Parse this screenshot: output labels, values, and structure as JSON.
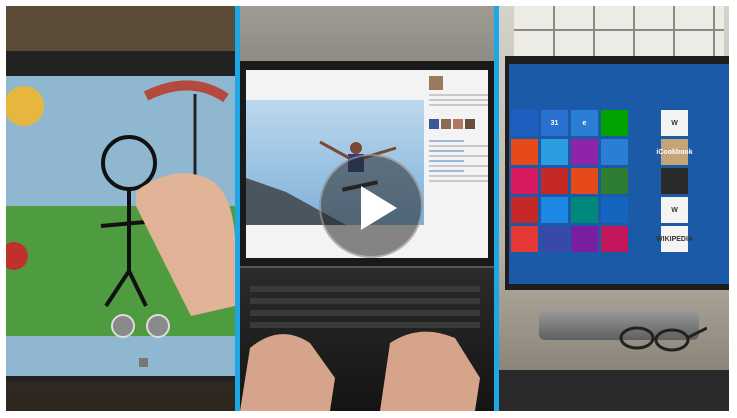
{
  "video": {
    "play_button_label": "Play video",
    "separator_color": "#1ea7e6"
  },
  "start_screen": {
    "tiles": [
      {
        "label": "",
        "color": "#1f5fbf",
        "icon": "tile"
      },
      {
        "label": "31",
        "color": "#2a72d1",
        "icon": "calendar-icon"
      },
      {
        "label": "e",
        "color": "#2a7fd4",
        "icon": "ie-icon"
      },
      {
        "label": "",
        "color": "#00a300",
        "icon": "store-icon"
      },
      {
        "label": "",
        "color": "transparent",
        "icon": ""
      },
      {
        "label": "W",
        "color": "#f4f4f4",
        "icon": "wordpress-icon"
      },
      {
        "label": "",
        "color": "#e64a19",
        "icon": "tile"
      },
      {
        "label": "",
        "color": "#2d9be0",
        "icon": "people-icon"
      },
      {
        "label": "",
        "color": "#8e24aa",
        "icon": "photos-icon"
      },
      {
        "label": "",
        "color": "#2a7fd4",
        "icon": "weather-icon"
      },
      {
        "label": "",
        "color": "transparent",
        "icon": ""
      },
      {
        "label": "iCookbook",
        "color": "#c4a57a",
        "icon": "cookbook-icon"
      },
      {
        "label": "",
        "color": "#d81b60",
        "icon": "tile"
      },
      {
        "label": "",
        "color": "#c62828",
        "icon": "video-icon"
      },
      {
        "label": "",
        "color": "#e64a19",
        "icon": "music-icon"
      },
      {
        "label": "",
        "color": "#2e7d32",
        "icon": "tile"
      },
      {
        "label": "",
        "color": "transparent",
        "icon": ""
      },
      {
        "label": "",
        "color": "#2b2b2b",
        "icon": "tile"
      },
      {
        "label": "",
        "color": "#c62828",
        "icon": "tile"
      },
      {
        "label": "",
        "color": "#1e88e5",
        "icon": "weather-icon"
      },
      {
        "label": "",
        "color": "#00897b",
        "icon": "finance-icon"
      },
      {
        "label": "",
        "color": "#1565c0",
        "icon": "tile"
      },
      {
        "label": "",
        "color": "transparent",
        "icon": ""
      },
      {
        "label": "W",
        "color": "#f4f4f4",
        "icon": "tile"
      },
      {
        "label": "",
        "color": "#e53935",
        "icon": "tile"
      },
      {
        "label": "",
        "color": "#3949ab",
        "icon": "tile"
      },
      {
        "label": "",
        "color": "#7b1fa2",
        "icon": "tile"
      },
      {
        "label": "",
        "color": "#c2185b",
        "icon": "tile"
      },
      {
        "label": "",
        "color": "transparent",
        "icon": ""
      },
      {
        "label": "WIKIPEDIA",
        "color": "#f4f4f4",
        "icon": "wikipedia-icon"
      }
    ]
  }
}
